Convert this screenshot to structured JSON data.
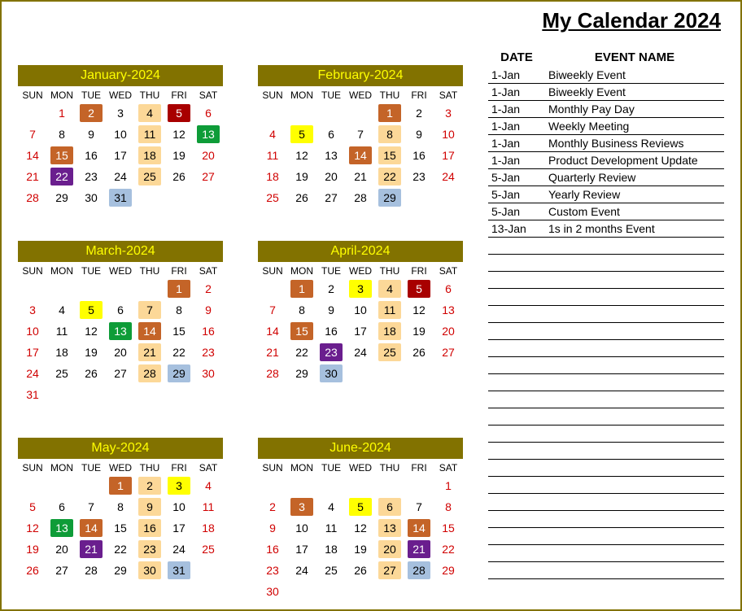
{
  "title": "My Calendar 2024",
  "dows": [
    "SUN",
    "MON",
    "TUE",
    "WED",
    "THU",
    "FRI",
    "SAT"
  ],
  "eventsHeader": {
    "date": "DATE",
    "name": "EVENT NAME"
  },
  "events": [
    {
      "date": "1-Jan",
      "name": "Biweekly Event"
    },
    {
      "date": "1-Jan",
      "name": "Biweekly Event"
    },
    {
      "date": "1-Jan",
      "name": "Monthly Pay Day"
    },
    {
      "date": "1-Jan",
      "name": "Weekly Meeting"
    },
    {
      "date": "1-Jan",
      "name": "Monthly Business Reviews"
    },
    {
      "date": "1-Jan",
      "name": "Product Development Update"
    },
    {
      "date": "5-Jan",
      "name": "Quarterly Review"
    },
    {
      "date": "5-Jan",
      "name": "Yearly Review"
    },
    {
      "date": "5-Jan",
      "name": "Custom Event"
    },
    {
      "date": "13-Jan",
      "name": "1s in 2 months Event"
    }
  ],
  "emptyEventRows": 20,
  "months": [
    {
      "label": "January-2024",
      "startDow": 1,
      "numDays": 31,
      "prevTrail": 0,
      "weekendCol": [
        0,
        6
      ],
      "highlights": {
        "1": "red",
        "2": [
          "orange",
          "white"
        ],
        "4": "peach",
        "5": [
          "darkred",
          "white"
        ],
        "6": "red",
        "7": "red",
        "11": "peach",
        "13": [
          "green",
          "white"
        ],
        "14": "red",
        "15": [
          "orange",
          "white"
        ],
        "18": "peach",
        "20": "red",
        "21": "red",
        "22": [
          "purple",
          "white"
        ],
        "25": "peach",
        "27": "red",
        "28": "red",
        "31": "lblue"
      }
    },
    {
      "label": "February-2024",
      "startDow": 4,
      "numDays": 29,
      "prevTrail": 0,
      "highlights": {
        "1": [
          "orange",
          "white"
        ],
        "3": "red",
        "4": "red",
        "5": [
          "yellow",
          "black"
        ],
        "8": "peach",
        "10": "red",
        "11": "red",
        "14": [
          "orange",
          "white"
        ],
        "15": "peach",
        "17": "red",
        "18": "red",
        "22": "peach",
        "24": "red",
        "25": "red",
        "29": "lblue"
      }
    },
    {
      "label": "March-2024",
      "startDow": 5,
      "numDays": 31,
      "prevTrail": 0,
      "highlights": {
        "1": [
          "orange",
          "white"
        ],
        "2": "red",
        "3": "red",
        "5": [
          "yellow",
          "black"
        ],
        "7": "peach",
        "9": "red",
        "10": "red",
        "13": [
          "green",
          "white"
        ],
        "14": [
          "orange",
          "white"
        ],
        "16": "red",
        "17": "red",
        "21": "peach",
        "23": "red",
        "24": "red",
        "28": "peach",
        "29": "lblue",
        "30": "red",
        "31": "red"
      }
    },
    {
      "label": "April-2024",
      "startDow": 1,
      "numDays": 30,
      "prevTrail": 0,
      "highlights": {
        "1": [
          "orange",
          "white"
        ],
        "3": [
          "yellow",
          "black"
        ],
        "4": "peach",
        "5": [
          "darkred",
          "white"
        ],
        "6": "red",
        "7": "red",
        "11": "peach",
        "13": "red",
        "14": "red",
        "15": [
          "orange",
          "white"
        ],
        "18": "peach",
        "20": "red",
        "21": "red",
        "23": [
          "purple",
          "white"
        ],
        "25": "peach",
        "27": "red",
        "28": "red",
        "30": "lblue"
      }
    },
    {
      "label": "May-2024",
      "startDow": 3,
      "numDays": 31,
      "prevTrail": 0,
      "highlights": {
        "1": [
          "orange",
          "white"
        ],
        "2": "peach",
        "3": [
          "yellow",
          "black"
        ],
        "4": "red",
        "5": "red",
        "9": "peach",
        "11": "red",
        "12": "red",
        "13": [
          "green",
          "white"
        ],
        "14": [
          "orange",
          "white"
        ],
        "16": "peach",
        "18": "red",
        "19": "red",
        "21": [
          "purple",
          "white"
        ],
        "23": "peach",
        "25": "red",
        "26": "red",
        "30": "peach",
        "31": "lblue"
      }
    },
    {
      "label": "June-2024",
      "startDow": 6,
      "numDays": 30,
      "prevTrail": 0,
      "highlights": {
        "1": "red",
        "2": "red",
        "3": [
          "orange",
          "white"
        ],
        "5": [
          "yellow",
          "black"
        ],
        "6": "peach",
        "8": "red",
        "9": "red",
        "13": "peach",
        "14": [
          "orange",
          "white"
        ],
        "15": "red",
        "16": "red",
        "20": "peach",
        "21": [
          "purple",
          "white"
        ],
        "22": "red",
        "23": "red",
        "27": "peach",
        "28": "lblue",
        "29": "red",
        "30": "red"
      }
    }
  ]
}
